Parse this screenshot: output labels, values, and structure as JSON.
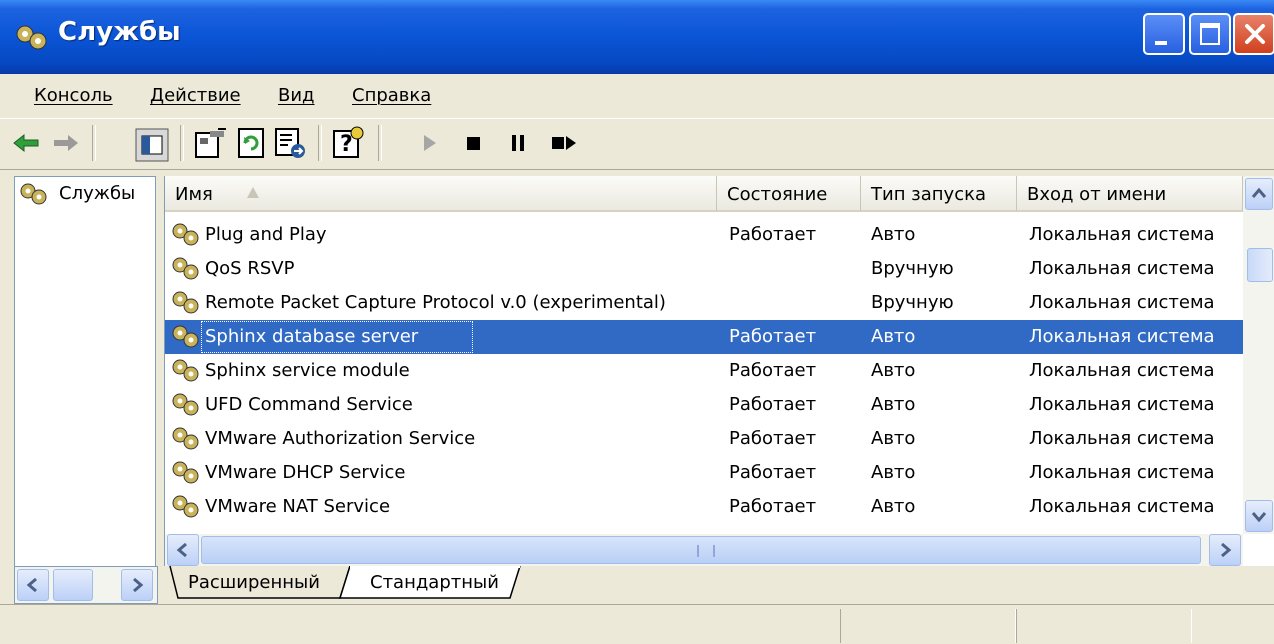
{
  "window": {
    "title": "Службы"
  },
  "menu": [
    "Консоль",
    "Действие",
    "Вид",
    "Справка"
  ],
  "toolbar": {
    "icons": [
      "back-arrow-icon",
      "forward-arrow-icon",
      "show-hide-tree-icon",
      "properties-icon",
      "refresh-icon",
      "export-list-icon",
      "help-icon",
      "start-service-icon",
      "stop-service-icon",
      "pause-service-icon",
      "restart-service-icon"
    ]
  },
  "tree": {
    "root": "Службы"
  },
  "columns": [
    "Имя",
    "Состояние",
    "Тип запуска",
    "Вход от имени"
  ],
  "services": [
    {
      "name": "Plug and Play",
      "state": "Работает",
      "startup": "Авто",
      "logon": "Локальная система"
    },
    {
      "name": "QoS RSVP",
      "state": "",
      "startup": "Вручную",
      "logon": "Локальная система"
    },
    {
      "name": "Remote Packet Capture Protocol v.0 (experimental)",
      "state": "",
      "startup": "Вручную",
      "logon": "Локальная система"
    },
    {
      "name": "Sphinx database server",
      "state": "Работает",
      "startup": "Авто",
      "logon": "Локальная система",
      "selected": true
    },
    {
      "name": "Sphinx service module",
      "state": "Работает",
      "startup": "Авто",
      "logon": "Локальная система"
    },
    {
      "name": "UFD Command Service",
      "state": "Работает",
      "startup": "Авто",
      "logon": "Локальная система"
    },
    {
      "name": "VMware Authorization Service",
      "state": "Работает",
      "startup": "Авто",
      "logon": "Локальная система"
    },
    {
      "name": "VMware DHCP Service",
      "state": "Работает",
      "startup": "Авто",
      "logon": "Локальная система"
    },
    {
      "name": "VMware NAT Service",
      "state": "Работает",
      "startup": "Авто",
      "logon": "Локальная система"
    }
  ],
  "tabs": [
    "Расширенный",
    "Стандартный"
  ],
  "colors": {
    "selection": "#316ac5",
    "titlebar": "#0a55d6",
    "close": "#d0401e"
  }
}
